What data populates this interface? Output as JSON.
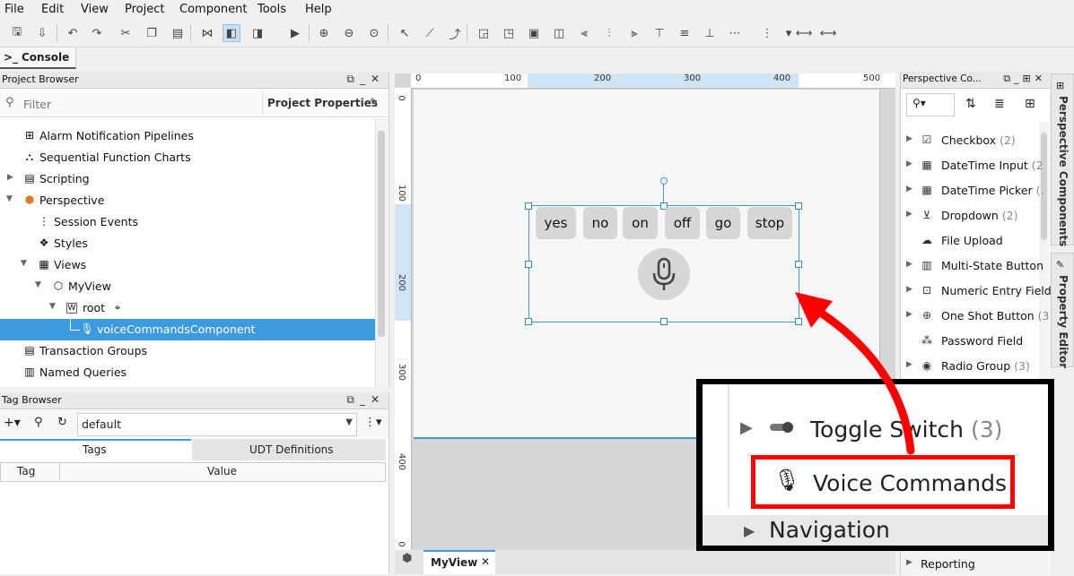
{
  "menu": [
    "File",
    "Edit",
    "View",
    "Project",
    "Component",
    "Tools",
    "Help"
  ],
  "console_tab": "Console",
  "project_browser": {
    "title": "Project Browser",
    "filter_placeholder": "Filter",
    "project_properties": "Project Properties",
    "tree": [
      {
        "label": "Alarm Notification Pipelines"
      },
      {
        "label": "Sequential Function Charts"
      },
      {
        "label": "Scripting"
      },
      {
        "label": "Perspective"
      },
      {
        "label": "Session Events"
      },
      {
        "label": "Styles"
      },
      {
        "label": "Views"
      },
      {
        "label": "MyView"
      },
      {
        "label": "root"
      },
      {
        "label": "voiceCommandsComponent"
      },
      {
        "label": "Transaction Groups"
      },
      {
        "label": "Named Queries"
      }
    ]
  },
  "tag_browser": {
    "title": "Tag Browser",
    "provider": "default",
    "tabs": [
      "Tags",
      "UDT Definitions"
    ],
    "columns": [
      "Tag",
      "Value"
    ]
  },
  "designer": {
    "ruler_h": [
      "0",
      "100",
      "200",
      "300",
      "400",
      "500"
    ],
    "ruler_v": [
      "0",
      "100",
      "200",
      "300",
      "400",
      "0"
    ],
    "buttons": [
      "yes",
      "no",
      "on",
      "off",
      "go",
      "stop"
    ],
    "tab": "MyView"
  },
  "palette": {
    "title": "Perspective Co...",
    "items": [
      {
        "label": "Checkbox",
        "count": "(2)"
      },
      {
        "label": "DateTime Input",
        "count": "(2"
      },
      {
        "label": "DateTime Picker",
        "count": "(."
      },
      {
        "label": "Dropdown",
        "count": "(2)"
      },
      {
        "label": "File Upload",
        "count": ""
      },
      {
        "label": "Multi-State Button",
        "count": ""
      },
      {
        "label": "Numeric Entry Field",
        "count": ""
      },
      {
        "label": "One Shot Button",
        "count": "(3"
      },
      {
        "label": "Password Field",
        "count": ""
      },
      {
        "label": "Radio Group",
        "count": "(3)"
      }
    ],
    "bottom_item": "Reporting"
  },
  "side_tabs": [
    "Perspective Components",
    "Property Editor"
  ],
  "zoom": {
    "toggle_switch": "Toggle Switch",
    "toggle_count": "(3)",
    "voice_commands": "Voice Commands",
    "navigation": "Navigation"
  },
  "colors": {
    "highlight": "#ff0000",
    "selection": "#3d9ae0",
    "accent": "#2b8ad6"
  }
}
